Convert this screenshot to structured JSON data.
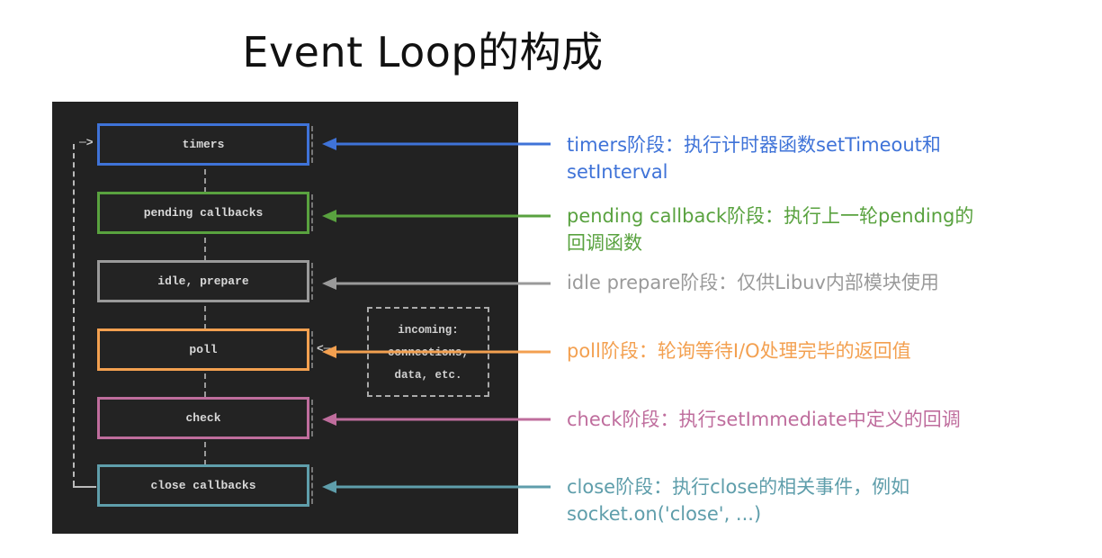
{
  "title": "Event Loop的构成",
  "diagram": {
    "phases": [
      {
        "id": "timers",
        "label": "timers",
        "color": "#3f73d8"
      },
      {
        "id": "pending",
        "label": "pending callbacks",
        "color": "#59a23f"
      },
      {
        "id": "idle",
        "label": "idle, prepare",
        "color": "#9a9a9a"
      },
      {
        "id": "poll",
        "label": "poll",
        "color": "#f3a050"
      },
      {
        "id": "check",
        "label": "check",
        "color": "#bf6d9d"
      },
      {
        "id": "close",
        "label": "close callbacks",
        "color": "#5f9eab"
      }
    ],
    "incoming": {
      "line1": "incoming:",
      "line2": "connections,",
      "line3": "data, etc."
    },
    "loop_arrow": "─>",
    "incoming_arrow": "<─"
  },
  "descriptions": [
    {
      "id": "timers",
      "line1": "timers阶段：执行计时器函数setTimeout和",
      "line2": "setInterval",
      "color": "#3f73d8"
    },
    {
      "id": "pending",
      "line1": "pending callback阶段：执行上一轮pending的",
      "line2": "回调函数",
      "color": "#59a23f"
    },
    {
      "id": "idle",
      "line1": "idle prepare阶段：仅供Libuv内部模块使用",
      "line2": "",
      "color": "#9a9a9a"
    },
    {
      "id": "poll",
      "line1": "poll阶段：轮询等待I/O处理完毕的返回值",
      "line2": "",
      "color": "#f3a050"
    },
    {
      "id": "check",
      "line1": "check阶段：执行setImmediate中定义的回调",
      "line2": "",
      "color": "#bf6d9d"
    },
    {
      "id": "close",
      "line1": "close阶段：执行close的相关事件，例如",
      "line2": "socket.on('close', ...)",
      "color": "#5f9eab"
    }
  ]
}
